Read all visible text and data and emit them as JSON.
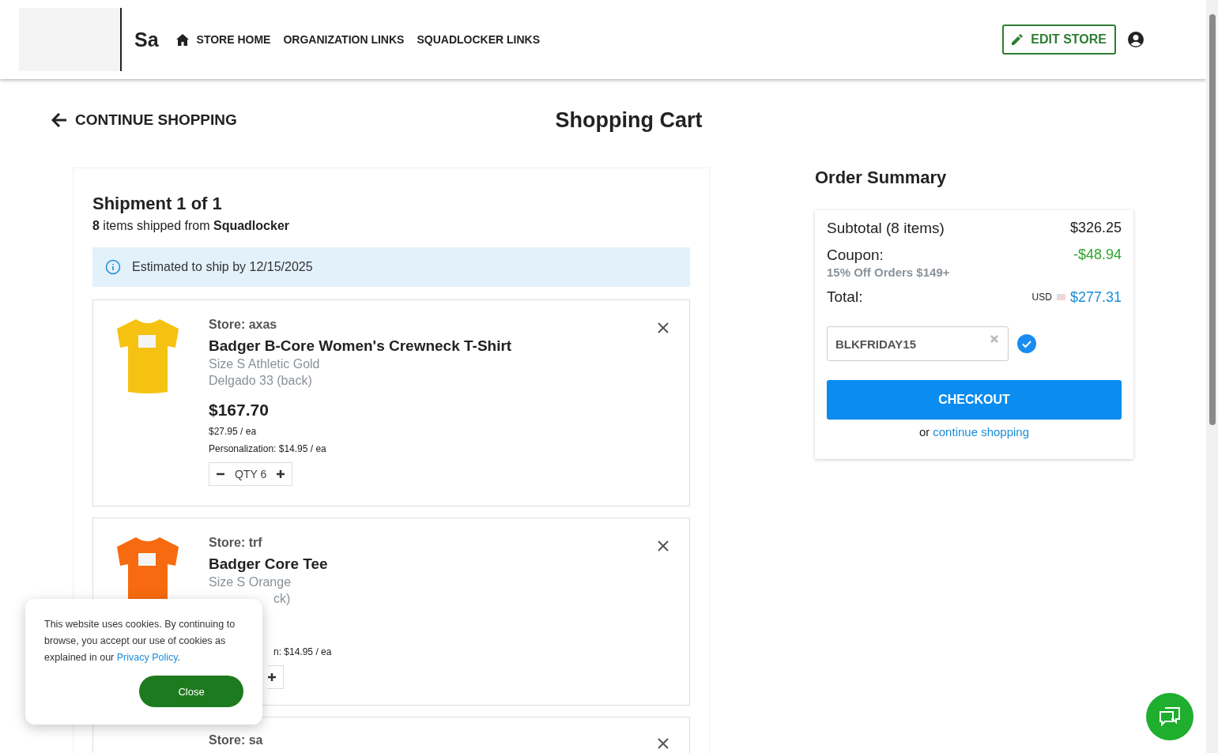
{
  "header": {
    "logo_text": "Sa",
    "nav": [
      {
        "label": "STORE HOME",
        "kind": "home"
      },
      {
        "label": "ORGANIZATION LINKS",
        "kind": "plain"
      },
      {
        "label": "SQUADLOCKER LINKS",
        "kind": "plain"
      }
    ],
    "edit_button": "EDIT STORE"
  },
  "back_link": "CONTINUE SHOPPING",
  "page_title": "Shopping Cart",
  "shipment": {
    "title": "Shipment 1 of 1",
    "summary": "**8** items shipped from **Squadlocker**",
    "notice": "Estimated to ship by 12/15/2025"
  },
  "items": [
    {
      "kind": "full",
      "store": "Store: axas",
      "name": "Badger B-Core Women's Crewneck T-Shirt",
      "color": "#f5c211",
      "variants": [
        "Size S Athletic Gold",
        "Delgado 33 (back)"
      ],
      "price": "$167.70",
      "each": "$27.95 / ea",
      "personalization": "Personalization: $14.95 / ea",
      "qty": "QTY 6"
    },
    {
      "kind": "covered",
      "store": "Store: trf",
      "name": "Badger Core Tee",
      "color": "#f76a0f",
      "variants": [
        "Size S Orange"
      ],
      "partial_variant": "ck)",
      "partial_personalization": "n: $14.95 / ea"
    },
    {
      "kind": "cut",
      "store": "Store: sa"
    }
  ],
  "order_summary": {
    "title": "Order Summary",
    "subtotal_label": "Subtotal (8 items)",
    "subtotal": "$326.25",
    "coupon_label": "Coupon:",
    "coupon_name": "15% Off Orders $149+",
    "coupon_amount": "-$48.94",
    "total_label": "Total:",
    "currency": "USD",
    "total": "$277.31",
    "coupon_code": "BLKFRIDAY15",
    "coupon_applied": true,
    "checkout": "CHECKOUT",
    "or_text": "or",
    "continue_link": "continue shopping"
  },
  "cookie_notice": {
    "text_before": "This website uses cookies. By continuing to browse, you accept our use of cookies as explained in our ",
    "link": "Privacy Policy",
    "text_after": ".",
    "button": "Close"
  }
}
